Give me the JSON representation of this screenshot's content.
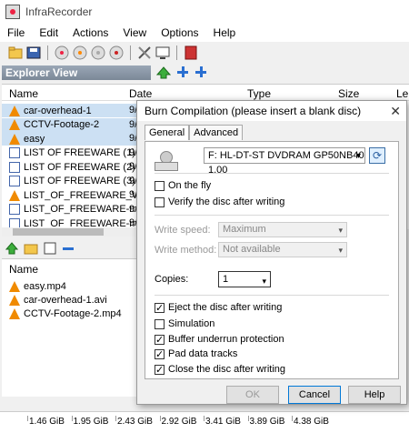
{
  "window": {
    "title": "InfraRecorder"
  },
  "menu": {
    "items": [
      "File",
      "Edit",
      "Actions",
      "View",
      "Options",
      "Help"
    ]
  },
  "explorer": {
    "title": "Explorer View",
    "columns": [
      "Name",
      "Date",
      "Type",
      "Size",
      "Le"
    ],
    "files": [
      {
        "name": "car-overhead-1",
        "date": "9/",
        "type": "cone",
        "selected": true
      },
      {
        "name": "CCTV-Footage-2",
        "date": "9/",
        "type": "cone",
        "selected": true
      },
      {
        "name": "easy",
        "date": "9/",
        "type": "cone",
        "selected": true
      },
      {
        "name": "LIST OF FREEWARE (1)",
        "date": "9/",
        "type": "doc",
        "selected": false
      },
      {
        "name": "LIST OF FREEWARE (2)",
        "date": "9/",
        "type": "doc",
        "selected": false
      },
      {
        "name": "LIST OF FREEWARE (3)",
        "date": "9/",
        "type": "doc",
        "selected": false
      },
      {
        "name": "LIST_OF_FREEWARE_Vi",
        "date": "9/",
        "type": "cone",
        "selected": false
      },
      {
        "name": "LIST_OF_FREEWARE-m",
        "date": "9/",
        "type": "doc",
        "selected": false
      },
      {
        "name": "LIST_OF_FREEWARE-m",
        "date": "9/",
        "type": "doc",
        "selected": false
      }
    ]
  },
  "compilation": {
    "columns": [
      "Name"
    ],
    "files": [
      {
        "name": "easy.mp4",
        "type": "cone"
      },
      {
        "name": "car-overhead-1.avi",
        "type": "cone"
      },
      {
        "name": "CCTV-Footage-2.mp4",
        "type": "cone"
      }
    ]
  },
  "statusbar": {
    "ticks": [
      "1.46 GiB",
      "1.95 GiB",
      "2.43 GiB",
      "2.92 GiB",
      "3.41 GiB",
      "3.89 GiB",
      "4.38 GiB"
    ]
  },
  "dialog": {
    "title": "Burn Compilation (please insert a blank disc)",
    "tabs": [
      "General",
      "Advanced"
    ],
    "drive": "F: HL-DT-ST DVDRAM GP50NB40 1.00",
    "on_the_fly": "On the fly",
    "verify": "Verify the disc after writing",
    "write_speed_label": "Write speed:",
    "write_speed_value": "Maximum",
    "write_method_label": "Write method:",
    "write_method_value": "Not available",
    "copies_label": "Copies:",
    "copies_value": "1",
    "eject": "Eject the disc after writing",
    "simulation": "Simulation",
    "buffer": "Buffer underrun protection",
    "pad": "Pad data tracks",
    "close_disc": "Close the disc after writing",
    "ok": "OK",
    "cancel": "Cancel",
    "help": "Help",
    "close_glyph": "✕"
  }
}
